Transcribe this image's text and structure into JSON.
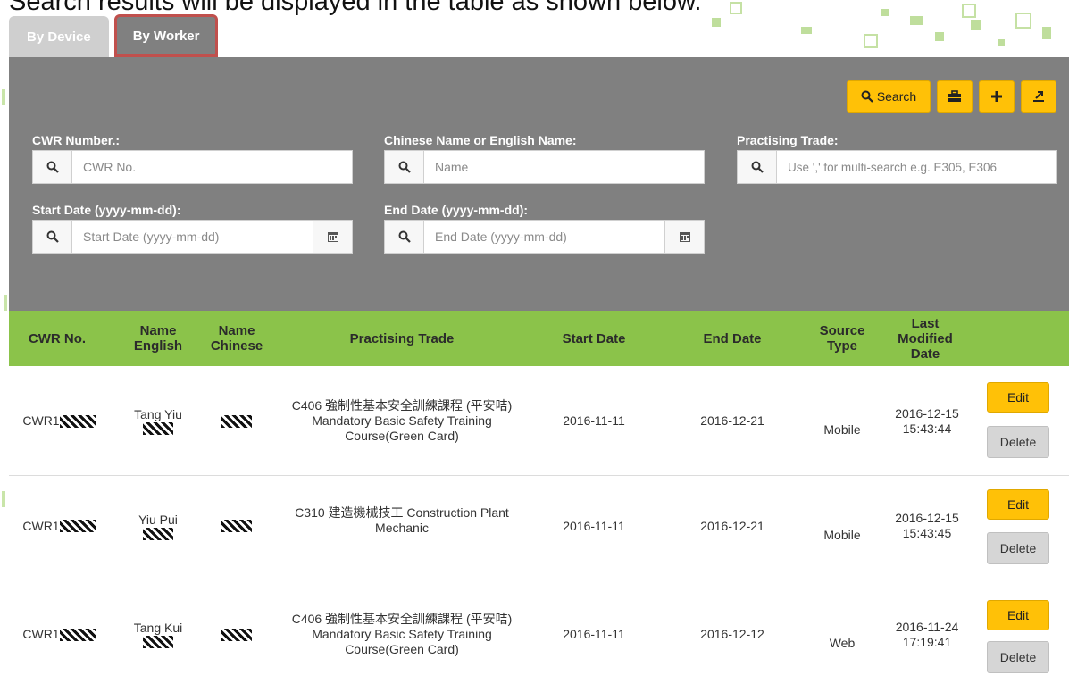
{
  "caption": "Search results will be displayed in the table as shown below.",
  "tabs": [
    {
      "label": "By Device",
      "active": false
    },
    {
      "label": "By Worker",
      "active": true
    }
  ],
  "toolbar": {
    "search_label": "Search",
    "icons": [
      "search-icon",
      "briefcase-icon",
      "plus-icon",
      "export-icon"
    ]
  },
  "form": {
    "cwr": {
      "label": "CWR Number.:",
      "placeholder": "CWR No."
    },
    "name": {
      "label": "Chinese Name or English Name:",
      "placeholder": "Name"
    },
    "trade": {
      "label": "Practising Trade:",
      "placeholder": "Use ',' for multi-search e.g. E305, E306"
    },
    "start": {
      "label": "Start Date (yyyy-mm-dd):",
      "placeholder": "Start Date (yyyy-mm-dd)"
    },
    "end": {
      "label": "End Date (yyyy-mm-dd):",
      "placeholder": "End Date (yyyy-mm-dd)"
    }
  },
  "table": {
    "headers": [
      "CWR No.",
      "Name English",
      "Name Chinese",
      "Practising Trade",
      "Start Date",
      "End Date",
      "Source Type",
      "Last Modified Date"
    ],
    "edit_label": "Edit",
    "delete_label": "Delete",
    "rows": [
      {
        "cwr_prefix": "CWR1",
        "name_en": "Tang Yiu",
        "trade": "C406 強制性基本安全訓練課程 (平安咭) Mandatory Basic Safety Training Course(Green Card)",
        "start": "2016-11-11",
        "end": "2016-12-21",
        "source": "Mobile",
        "modified": "2016-12-15 15:43:44"
      },
      {
        "cwr_prefix": "CWR1",
        "name_en": "Yiu Pui",
        "trade": "C310 建造機械技工 Construction Plant Mechanic",
        "start": "2016-11-11",
        "end": "2016-12-21",
        "source": "Mobile",
        "modified": "2016-12-15 15:43:45"
      },
      {
        "cwr_prefix": "CWR1",
        "name_en": "Tang Kui",
        "trade": "C406 強制性基本安全訓練課程 (平安咭) Mandatory Basic Safety Training Course(Green Card)",
        "start": "2016-11-11",
        "end": "2016-12-12",
        "source": "Web",
        "modified": "2016-11-24 17:19:41"
      }
    ]
  },
  "colors": {
    "panel": "#808080",
    "header_green": "#8bc34a",
    "accent_yellow": "#ffc107",
    "tab_highlight": "#c0504d"
  }
}
